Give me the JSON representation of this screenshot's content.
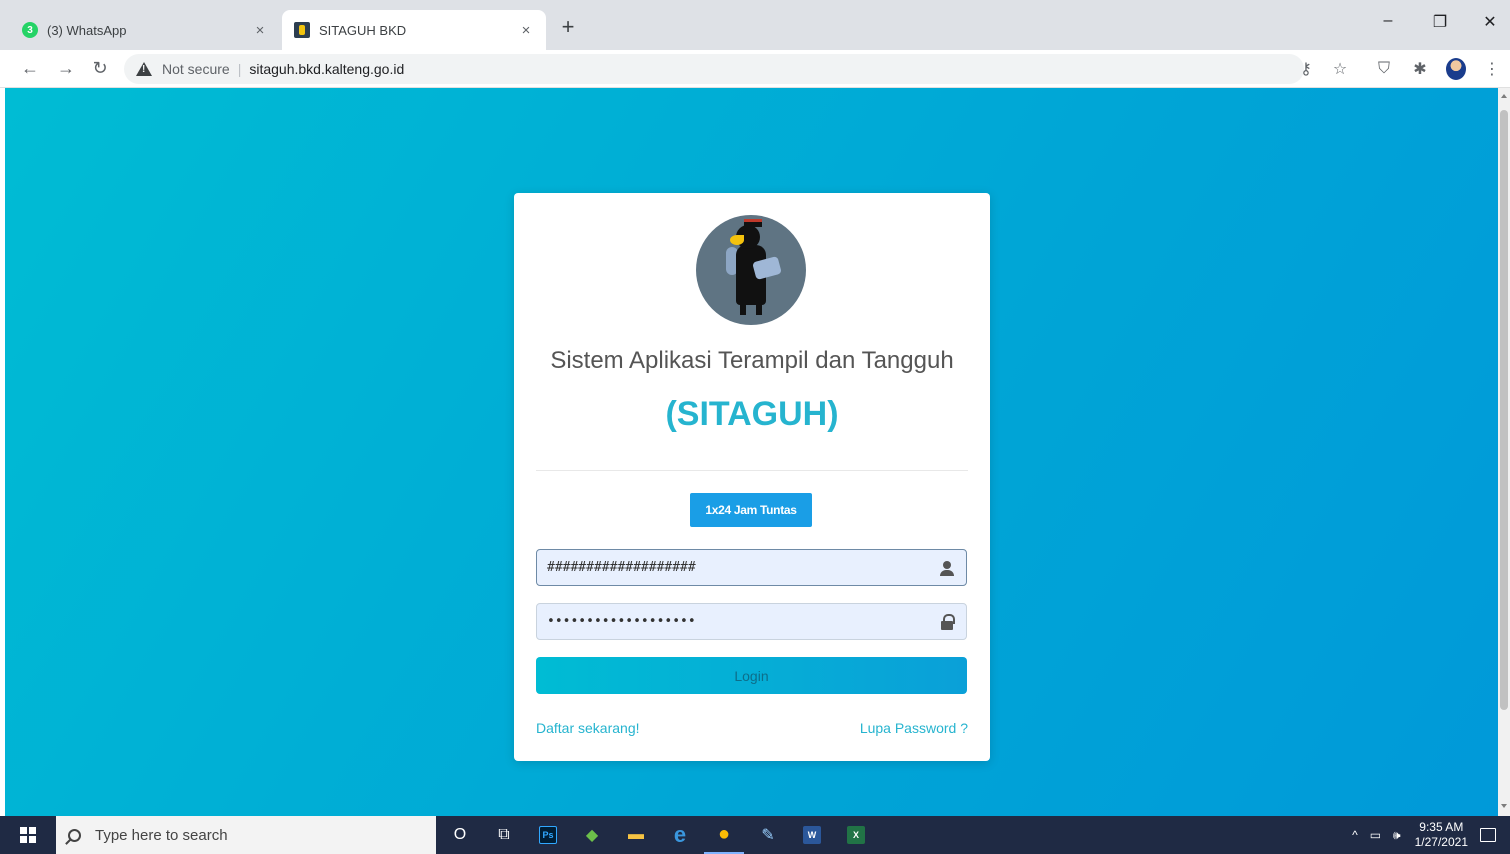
{
  "browser": {
    "tabs": [
      {
        "title": "(3) WhatsApp",
        "badge": "3",
        "icon": "whatsapp-icon",
        "active": false
      },
      {
        "title": "SITAGUH BKD",
        "icon": "sitaguh-favicon",
        "active": true
      }
    ],
    "close_glyph": "×",
    "new_tab_glyph": "+",
    "window_controls": {
      "minimize": "–",
      "restore": "❐",
      "close": "✕"
    },
    "nav": {
      "back": "←",
      "forward": "→",
      "reload": "↻"
    },
    "security_label": "Not secure",
    "separator": "|",
    "url": "sitaguh.bkd.kalteng.go.id",
    "toolbar_icons": {
      "key": "⚷",
      "star": "☆",
      "shield": "⛉",
      "puzzle": "✱",
      "menu": "⋮"
    }
  },
  "login": {
    "title": "Sistem Aplikasi Terampil dan Tangguh",
    "subtitle": "(SITAGUH)",
    "badge_button": "1x24 Jam Tuntas",
    "username_value": "###################",
    "password_value": "•••••••••••••••••••",
    "login_button": "Login",
    "register_link": "Daftar sekarang!",
    "forgot_link": "Lupa Password ?"
  },
  "colors": {
    "accent": "#26b4cf",
    "badge_bg": "#1a9ee6",
    "bg_gradient_start": "#00bcd4",
    "bg_gradient_end": "#0099d9"
  },
  "taskbar": {
    "search_placeholder": "Type here to search",
    "apps": [
      {
        "name": "cortana-icon",
        "glyph": "O"
      },
      {
        "name": "task-view-icon",
        "glyph": "⧉"
      },
      {
        "name": "photoshop-icon",
        "glyph": "Ps"
      },
      {
        "name": "lime-app-icon",
        "glyph": "◆"
      },
      {
        "name": "file-explorer-icon",
        "glyph": "▬"
      },
      {
        "name": "edge-icon",
        "glyph": "e"
      },
      {
        "name": "chrome-icon",
        "glyph": "●"
      },
      {
        "name": "paint-icon",
        "glyph": "✎"
      },
      {
        "name": "word-icon",
        "glyph": "W"
      },
      {
        "name": "excel-icon",
        "glyph": "X"
      }
    ],
    "tray": {
      "chevron": "^",
      "battery": "▭",
      "volume": "🕪"
    },
    "time": "9:35 AM",
    "date": "1/27/2021"
  }
}
